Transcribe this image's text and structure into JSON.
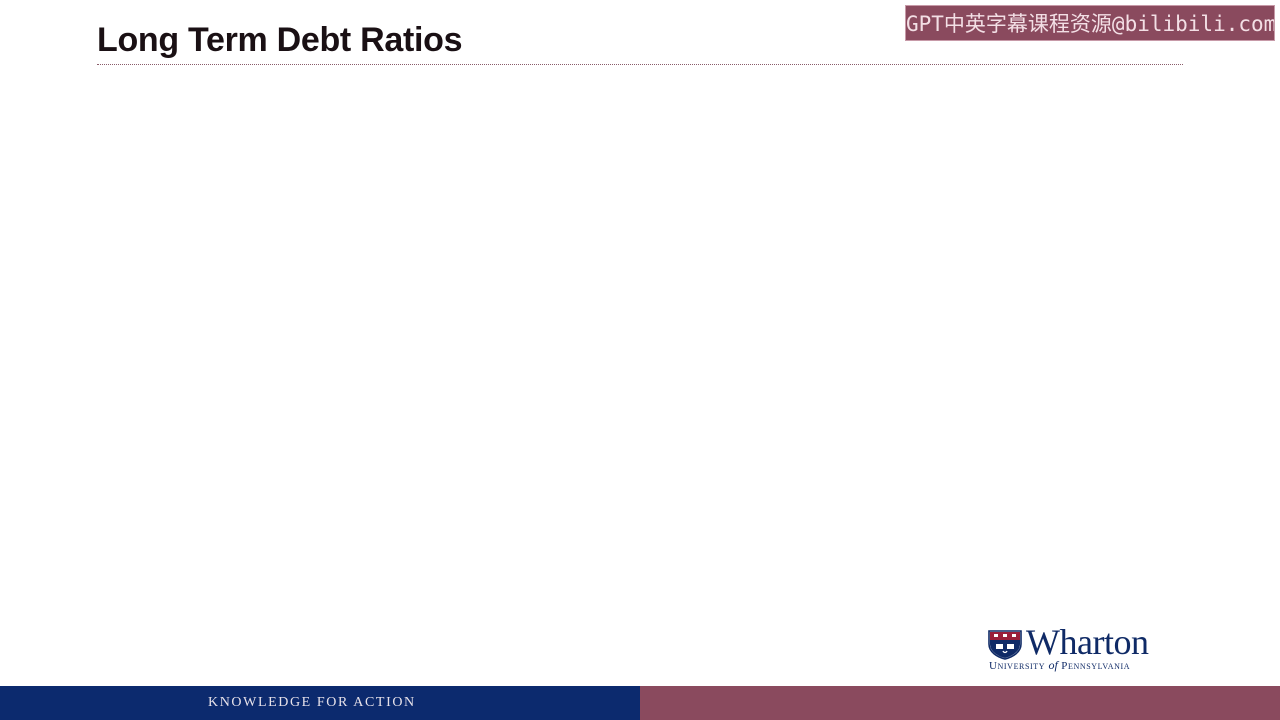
{
  "slide": {
    "title": "Long Term Debt Ratios"
  },
  "watermark": {
    "text": "GPT中英字幕课程资源@bilibili.com"
  },
  "logo": {
    "wordmark": "Wharton",
    "sub_university": "University",
    "sub_of": "of",
    "sub_state": "Pennsylvania",
    "icon": "penn-shield-icon"
  },
  "footer": {
    "tagline": "KNOWLEDGE FOR ACTION"
  },
  "colors": {
    "title": "#1a1014",
    "navy": "#0c2a6e",
    "maroon": "#8a4a5e",
    "logo_blue": "#0f2a66"
  }
}
